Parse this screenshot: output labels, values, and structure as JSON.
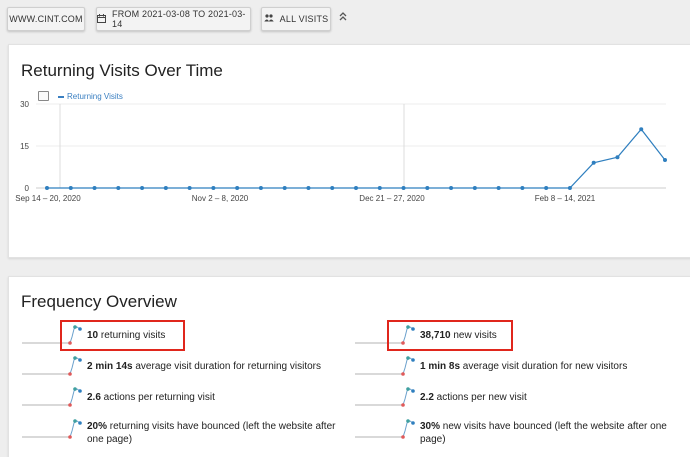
{
  "topbar": {
    "site_label": "WWW.CINT.COM",
    "date_label": "FROM 2021-03-08 TO 2021-03-14",
    "segment_label": "ALL VISITS",
    "collapse_icon": "chevron-double-up-icon"
  },
  "chart_card": {
    "title": "Returning Visits Over Time"
  },
  "chart_data": {
    "type": "line",
    "title": "Returning Visits Over Time",
    "series": [
      {
        "name": "Returning Visits",
        "color": "#2f7fbf",
        "values": [
          0,
          0,
          0,
          0,
          0,
          0,
          0,
          0,
          0,
          0,
          0,
          0,
          0,
          0,
          0,
          0,
          0,
          0,
          0,
          0,
          0,
          0,
          0,
          9,
          11,
          21,
          10
        ]
      }
    ],
    "x_tick_labels": [
      "Sep 14 – 20, 2020",
      "Nov 2 – 8, 2020",
      "Dec 21 – 27, 2020",
      "Feb 8 – 14, 2021"
    ],
    "x_tick_index": [
      0,
      7,
      14,
      21
    ],
    "y_ticks": [
      "0",
      "15",
      "30"
    ],
    "ylim": [
      0,
      30
    ],
    "grid": true,
    "legend_position": "top-left"
  },
  "freq_card": {
    "title": "Frequency Overview",
    "rows": [
      {
        "bold": "10",
        "text": " returning visits"
      },
      {
        "bold": "38,710",
        "text": " new visits"
      },
      {
        "bold": "2 min 14s",
        "text": " average visit duration for returning visitors"
      },
      {
        "bold": "1 min 8s",
        "text": " average visit duration for new visitors"
      },
      {
        "bold": "2.6",
        "text": " actions per returning visit"
      },
      {
        "bold": "2.2",
        "text": " actions per new visit"
      },
      {
        "bold": "20%",
        "text": " returning visits have bounced (left the website after one page)"
      },
      {
        "bold": "30%",
        "text": " new visits have bounced (left the website after one page)"
      }
    ]
  },
  "colors": {
    "accent": "#2f7fbf",
    "highlight": "#e0261c",
    "spark_start": "#e05a5a",
    "spark_end": "#2f7fbf"
  }
}
